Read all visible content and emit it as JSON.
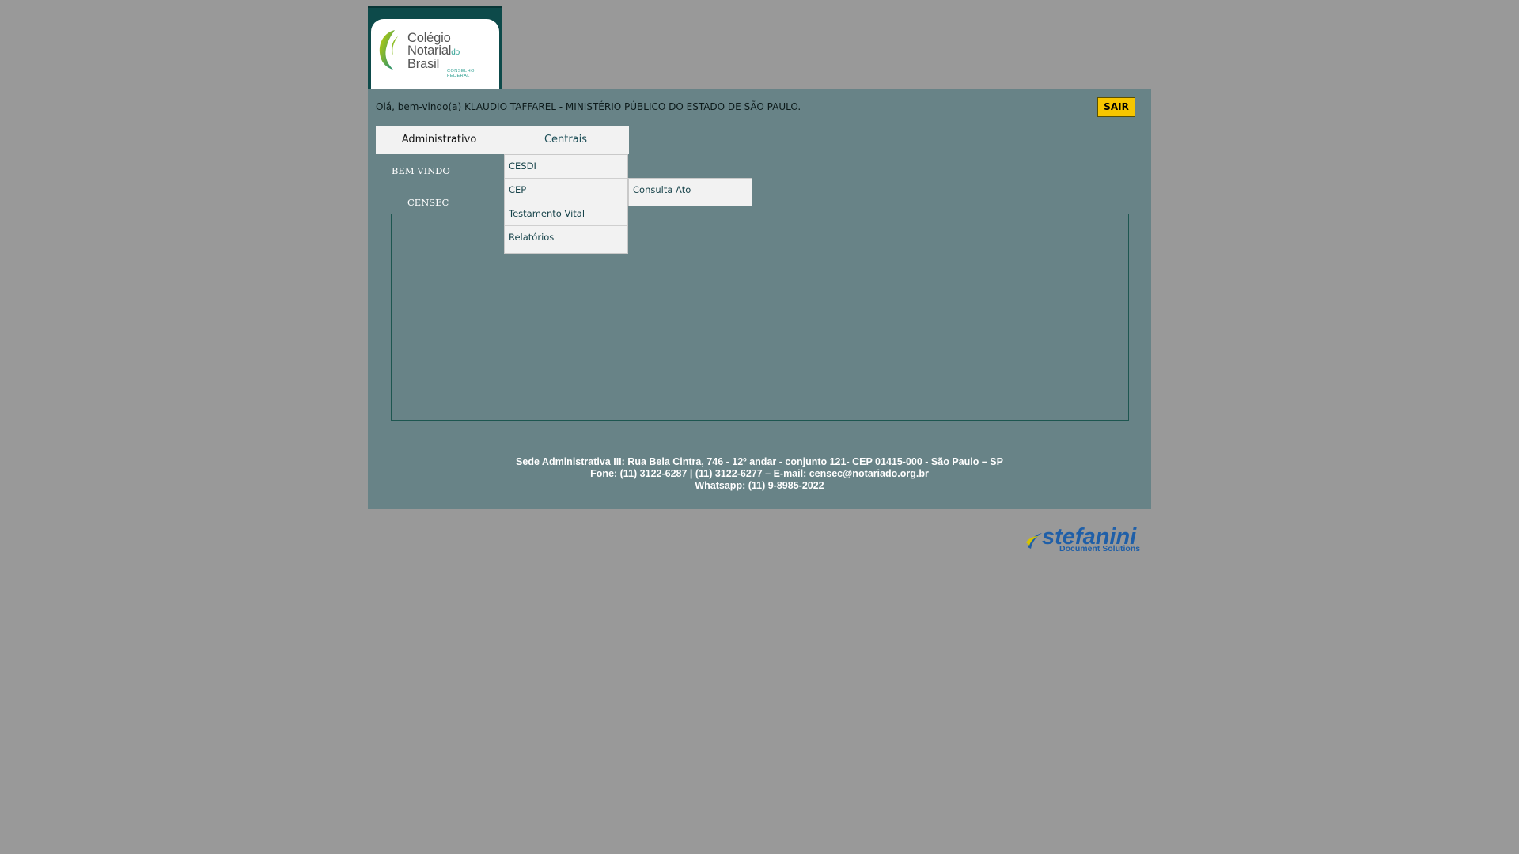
{
  "logo": {
    "line1": "Colégio",
    "line2": "Notarial",
    "line2_suffix": "do",
    "line3": "Brasil",
    "sub1": "CONSELHO",
    "sub2": "FEDERAL"
  },
  "header": {
    "welcome": "Olá, bem-vindo(a) KLAUDIO TAFFAREL - MINISTÉRIO PÚBLICO DO ESTADO DE SÃO PAULO.",
    "logout_label": "SAIR"
  },
  "menu": {
    "items": [
      {
        "label": "Administrativo"
      },
      {
        "label": "Centrais"
      }
    ]
  },
  "side_links": {
    "welcome": "BEM VINDO",
    "censec": "CENSEC"
  },
  "dropdown": {
    "items": [
      {
        "label": "CESDI"
      },
      {
        "label": "CEP"
      },
      {
        "label": "Testamento Vital"
      },
      {
        "label": "Relatórios"
      }
    ],
    "submenu": {
      "items": [
        {
          "label": "Consulta Ato"
        }
      ]
    }
  },
  "footer": {
    "line1": "Sede Administrativa III: Rua Bela Cintra, 746 - 12º andar - conjunto 121- CEP 01415-000 - São Paulo – SP",
    "line2": "Fone: (11) 3122-6287 | (11) 3122-6277 – E-mail: censec@notariado.org.br",
    "line3": "Whatsapp: (11) 9-8985-2022"
  },
  "vendor": {
    "name": "stefanini",
    "tagline": "Document Solutions"
  },
  "colors": {
    "page_bg": "#999999",
    "panel_bg": "#688387",
    "logout_bg": "#f7c600",
    "menu_bg": "#f2f2f2",
    "brand_blue": "#1f5fa8"
  }
}
